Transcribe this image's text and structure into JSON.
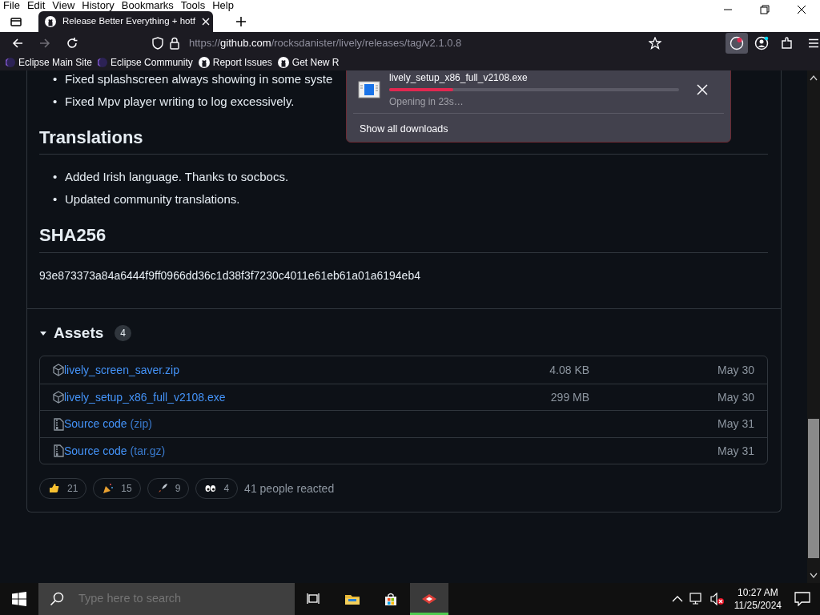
{
  "menu_bar": [
    "File",
    "Edit",
    "View",
    "History",
    "Bookmarks",
    "Tools",
    "Help"
  ],
  "tabs": [
    {
      "title": "Release Better Everything + hotf",
      "selected": true
    }
  ],
  "address_bar": {
    "scheme": "https://",
    "host": "github.com",
    "path": "/rocksdanister/lively/releases/tag/v2.1.0.8"
  },
  "bookmarks": [
    {
      "label": "Eclipse Main Site",
      "kind": "eclipse"
    },
    {
      "label": "Eclipse Community",
      "kind": "eclipse"
    },
    {
      "label": "Report Issues",
      "kind": "github"
    },
    {
      "label": "Get New R",
      "kind": "github"
    }
  ],
  "downloads_panel": {
    "file": "lively_setup_x86_full_v2108.exe",
    "level": 0.22,
    "status": "Opening in 23s…",
    "link": "Show all downloads"
  },
  "release": {
    "sections": [
      {
        "marker": "•",
        "items": [
          "Fixed splashscreen always showing in some syste",
          "Fixed Mpv player writing to log excessively."
        ]
      },
      {
        "heading": "Translations",
        "marker": "•",
        "items": [
          "Added Irish language. Thanks to socbocs.",
          "Updated community translations."
        ]
      },
      {
        "heading": "SHA256",
        "text": "93e873373a84a6444f9ff0966dd36c1d38f3f7230c4011e61eb61a01a6194eb4"
      }
    ],
    "assets": {
      "title": "Assets",
      "count": "4",
      "expanded": true,
      "rows": [
        {
          "kind": "package",
          "name": "lively_screen_saver.zip",
          "size": "4.08 KB",
          "date": "May 30"
        },
        {
          "kind": "package",
          "name": "lively_setup_x86_full_v2108.exe",
          "size": "299 MB",
          "date": "May 30"
        },
        {
          "kind": "source",
          "name": "Source code",
          "suffix": "(zip)",
          "date": "May 31"
        },
        {
          "kind": "source",
          "name": "Source code",
          "suffix": "(tar.gz)",
          "date": "May 31"
        }
      ]
    },
    "reactions": [
      {
        "kind": "thumbs-up",
        "count": "21"
      },
      {
        "kind": "party",
        "count": "15"
      },
      {
        "kind": "rocket",
        "count": "9"
      },
      {
        "kind": "eyes",
        "count": "4"
      }
    ],
    "reactions_summary": "41 people reacted"
  },
  "taskbar": {
    "search_placeholder": "Type here to search",
    "apps": [
      {
        "kind": "task-view",
        "active": false
      },
      {
        "kind": "explorer",
        "active": false
      },
      {
        "kind": "store",
        "active": false
      },
      {
        "kind": "app",
        "active": true
      }
    ],
    "time": "10:27 AM",
    "date": "11/25/2024"
  }
}
